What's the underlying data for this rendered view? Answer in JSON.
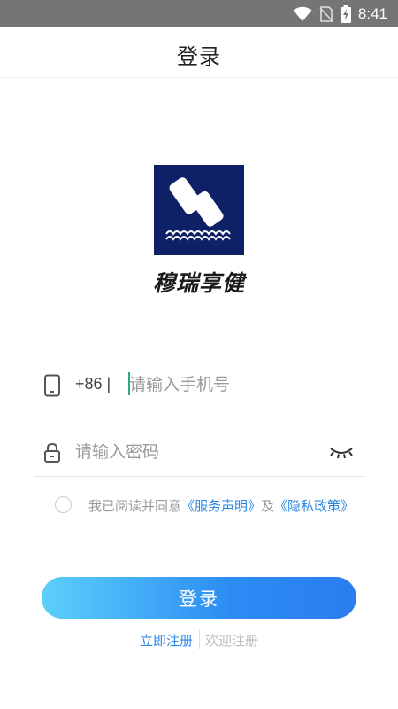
{
  "status_bar": {
    "time": "8:41",
    "icons": [
      "wifi-icon",
      "no-sim-icon",
      "battery-charging-icon"
    ]
  },
  "header": {
    "title": "登录"
  },
  "brand": {
    "name": "穆瑞享健",
    "logo_color": "#0f2166"
  },
  "phone": {
    "country_code": "+86 |",
    "placeholder": "请输入手机号",
    "value": ""
  },
  "password": {
    "placeholder": "请输入密码",
    "value": ""
  },
  "agreement": {
    "prefix": "我已阅读并同意",
    "service_link": "《服务声明》",
    "conjunction": "及",
    "privacy_link": "《隐私政策》"
  },
  "login_button": {
    "label": "登录"
  },
  "register": {
    "link_label": "立即注册",
    "welcome": "欢迎注册"
  },
  "colors": {
    "accent": "#2b88e6",
    "button_start": "#5ccff9",
    "button_end": "#2a7df0"
  }
}
